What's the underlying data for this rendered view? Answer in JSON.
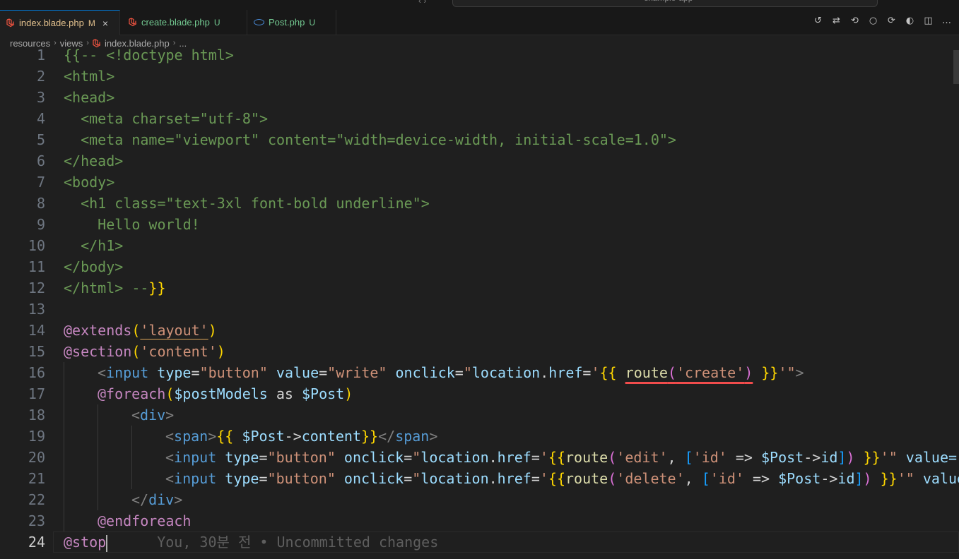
{
  "title_bar": {
    "search_text": "example-app",
    "nav_arrows": "‹ ›"
  },
  "tabs": [
    {
      "label": "index.blade.php",
      "status": "M",
      "color": "#e2c08d",
      "icon": "laravel-icon",
      "active": true,
      "close": "×"
    },
    {
      "label": "create.blade.php",
      "status": "U",
      "color": "#73c991",
      "icon": "laravel-icon",
      "active": false
    },
    {
      "label": "Post.php",
      "status": "U",
      "color": "#73c991",
      "icon": "php-icon",
      "active": false
    }
  ],
  "editor_actions": [
    "history-icon",
    "compare-changes-icon",
    "go-back-icon",
    "dot-icon",
    "go-forward-icon",
    "copilot-icon",
    "split-editor-icon",
    "more-actions-icon"
  ],
  "editor_action_glyphs": [
    "↺",
    "⇄",
    "⟲",
    "○",
    "⟳",
    "◐",
    "◫",
    "…"
  ],
  "breadcrumb": [
    "resources",
    "views",
    "index.blade.php",
    "..."
  ],
  "breadcrumb_sep": "›",
  "code": {
    "line_numbers": [
      "1",
      "2",
      "3",
      "4",
      "5",
      "6",
      "7",
      "8",
      "9",
      "10",
      "11",
      "12",
      "13",
      "14",
      "15",
      "16",
      "17",
      "18",
      "19",
      "20",
      "21",
      "22",
      "23",
      "24"
    ],
    "current_line": 24,
    "l1": "{{-- <!doctype html>",
    "l2": "<html>",
    "l3": "<head>",
    "l4": "  <meta charset=\"utf-8\">",
    "l5": "  <meta name=\"viewport\" content=\"width=device-width, initial-scale=1.0\">",
    "l6": "</head>",
    "l7": "<body>",
    "l8": "  <h1 class=\"text-3xl font-bold underline\">",
    "l9": "    Hello world!",
    "l10": "  </h1>",
    "l11": "</body>",
    "l12a": "</html> --",
    "l12b": "}}",
    "l14": {
      "dir": "@extends",
      "p1": "(",
      "str": "'layout'",
      "p2": ")"
    },
    "l15": {
      "dir": "@section",
      "p1": "(",
      "str": "'content'",
      "p2": ")"
    },
    "l16": {
      "lt": "<",
      "tag": "input",
      "a1": " type",
      "eq1": "=",
      "v1": "\"button\"",
      "a2": " value",
      "eq2": "=",
      "v2": "\"write\"",
      "a3": " onclick",
      "eq3": "=",
      "q1": "\"",
      "loc": "location",
      "dot": ".",
      "href": "href",
      "eq4": "=",
      "sq1": "'",
      "ob": "{{",
      "sp1": " ",
      "fn": "route",
      "p1": "(",
      "str": "'create'",
      "p2": ")",
      "sp2": " ",
      "cb": "}}",
      "sq2": "'",
      "q2": "\"",
      "gt": ">"
    },
    "l17": {
      "dir": "@foreach",
      "p1": "(",
      "var1": "$postModels",
      "as": " as ",
      "var2": "$Post",
      "p2": ")"
    },
    "l18": {
      "lt": "<",
      "tag": "div",
      "gt": ">"
    },
    "l19": {
      "lt": "<",
      "tag": "span",
      "gt": ">",
      "ob": "{{",
      "var": " $Post",
      "arrow": "->",
      "prop": "content",
      "cb": "}}",
      "lt2": "</",
      "tag2": "span",
      "gt2": ">"
    },
    "l20": {
      "lt": "<",
      "tag": "input",
      "a1": " type",
      "eq1": "=",
      "v1": "\"button\"",
      "a2": " onclick",
      "eq2": "=",
      "q1": "\"",
      "loc": "location",
      "dot": ".",
      "href": "href",
      "eq3": "=",
      "sq1": "'",
      "ob": "{{",
      "fn": "route",
      "p1": "(",
      "str": "'edit'",
      "comma": ", ",
      "bo": "[",
      "key": "'id'",
      "fat": " => ",
      "var": "$Post",
      "arrow": "->",
      "prop": "id",
      "bc": "]",
      "p2": ")",
      "sp": " ",
      "cb": "}}",
      "sq2": "'",
      "q2": "\"",
      "a3": " value=\""
    },
    "l21": {
      "lt": "<",
      "tag": "input",
      "a1": " type",
      "eq1": "=",
      "v1": "\"button\"",
      "a2": " onclick",
      "eq2": "=",
      "q1": "\"",
      "loc": "location",
      "dot": ".",
      "href": "href",
      "eq3": "=",
      "sq1": "'",
      "ob": "{{",
      "fn": "route",
      "p1": "(",
      "str": "'delete'",
      "comma": ", ",
      "bo": "[",
      "key": "'id'",
      "fat": " => ",
      "var": "$Post",
      "arrow": "->",
      "prop": "id",
      "bc": "]",
      "p2": ")",
      "sp": " ",
      "cb": "}}",
      "sq2": "'",
      "q2": "\"",
      "a3": " value"
    },
    "l22": {
      "lt": "</",
      "tag": "div",
      "gt": ">"
    },
    "l23": {
      "dir": "@endforeach"
    },
    "l24": {
      "dir": "@stop",
      "blame": "You, 30분 전 • Uncommitted changes"
    }
  }
}
